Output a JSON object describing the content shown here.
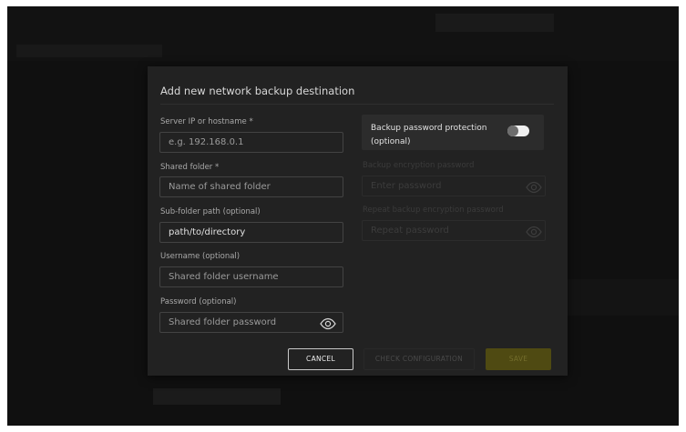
{
  "dialog": {
    "title": "Add new network backup destination"
  },
  "server": {
    "label": "Server IP or hostname *",
    "placeholder": "e.g. 192.168.0.1",
    "value": ""
  },
  "shared_folder": {
    "label": "Shared folder *",
    "placeholder": "Name of shared folder",
    "value": ""
  },
  "subfolder": {
    "label": "Sub-folder path (optional)",
    "placeholder": "",
    "value": "path/to/directory"
  },
  "username": {
    "label": "Username (optional)",
    "placeholder": "Shared folder username",
    "value": ""
  },
  "password": {
    "label": "Password (optional)",
    "placeholder": "Shared folder password",
    "value": "",
    "reveal_icon": "eye-icon"
  },
  "backup_protection": {
    "title": "Backup password protection (optional)",
    "enabled": false
  },
  "encryption_password": {
    "label": "Backup encryption password",
    "placeholder": "Enter password",
    "reveal_icon": "eye-icon"
  },
  "repeat_password": {
    "label": "Repeat backup encryption password",
    "placeholder": "Repeat password",
    "reveal_icon": "eye-icon"
  },
  "actions": {
    "cancel_label": "CANCEL",
    "check_label": "CHECK CONFIGURATION",
    "save_label": "SAVE"
  },
  "colors": {
    "dialog_bg": "#222222",
    "save_button": "#4f4a12",
    "toggle_track": "#f0f0f0"
  }
}
